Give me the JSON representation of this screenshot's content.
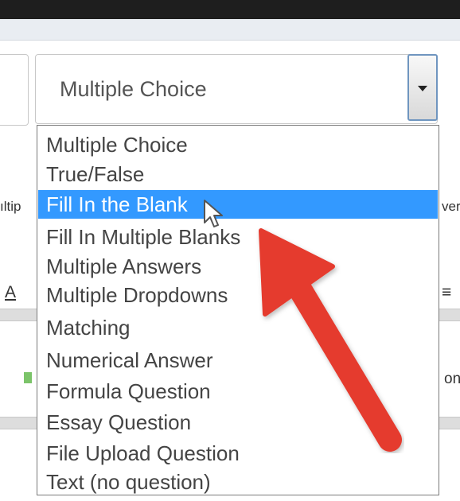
{
  "question_type_select": {
    "selected_value": "Multiple Choice",
    "arrow_icon": "chevron-down-icon",
    "options": [
      "Multiple Choice",
      "True/False",
      "Fill In the Blank",
      "Fill In Multiple Blanks",
      "Multiple Answers",
      "Multiple Dropdowns",
      "Matching",
      "Numerical Answer",
      "Formula Question",
      "Essay Question",
      "File Upload Question",
      "Text (no question)"
    ],
    "highlighted_option_index": 2,
    "highlight_color": "#3399ff"
  },
  "background_fragments": {
    "left_label": "ıltip",
    "right_label": "ver",
    "toolbar_left": "A",
    "toolbar_right": "≡",
    "right_text": "on"
  },
  "annotation": {
    "arrow_color": "#e53b2f",
    "pointer_icon": "mouse-pointer-icon"
  }
}
